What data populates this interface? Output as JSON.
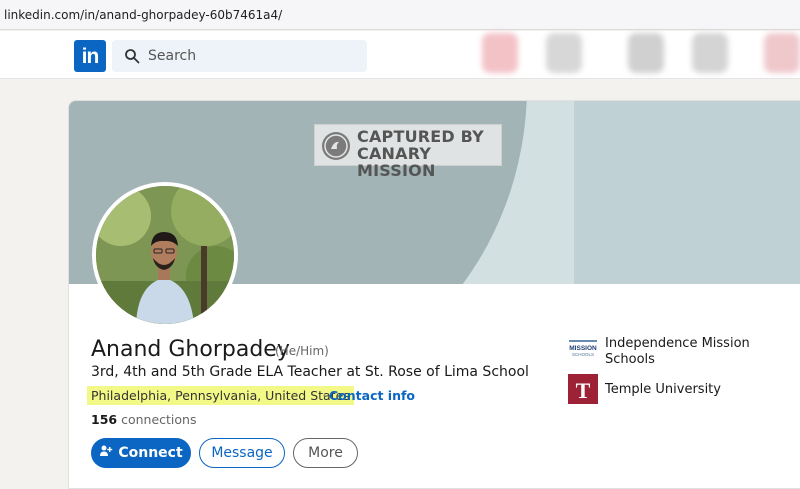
{
  "browser": {
    "url": "linkedin.com/in/anand-ghorpadey-60b7461a4/"
  },
  "nav": {
    "logo_text": "in",
    "search_placeholder": "Search"
  },
  "watermark": {
    "line1": "CAPTURED BY",
    "line2": "CANARY MISSION"
  },
  "profile": {
    "name": "Anand Ghorpadey",
    "pronouns": "(He/Him)",
    "headline": "3rd, 4th and 5th Grade ELA Teacher at St. Rose of Lima School",
    "location": "Philadelphia, Pennsylvania, United States",
    "separator": "·",
    "contact_info": "Contact info",
    "connections_count": "156",
    "connections_label": "connections"
  },
  "actions": {
    "connect": "Connect",
    "message": "Message",
    "more": "More"
  },
  "organizations": [
    {
      "name": "Independence Mission Schools",
      "logo_text": "MISSION",
      "logo_sub": "SCHOOLS"
    },
    {
      "name": "Temple University",
      "logo_text": "T"
    }
  ],
  "colors": {
    "brand": "#0a66c2",
    "highlight": "#f3f986",
    "temple": "#9d2235"
  }
}
